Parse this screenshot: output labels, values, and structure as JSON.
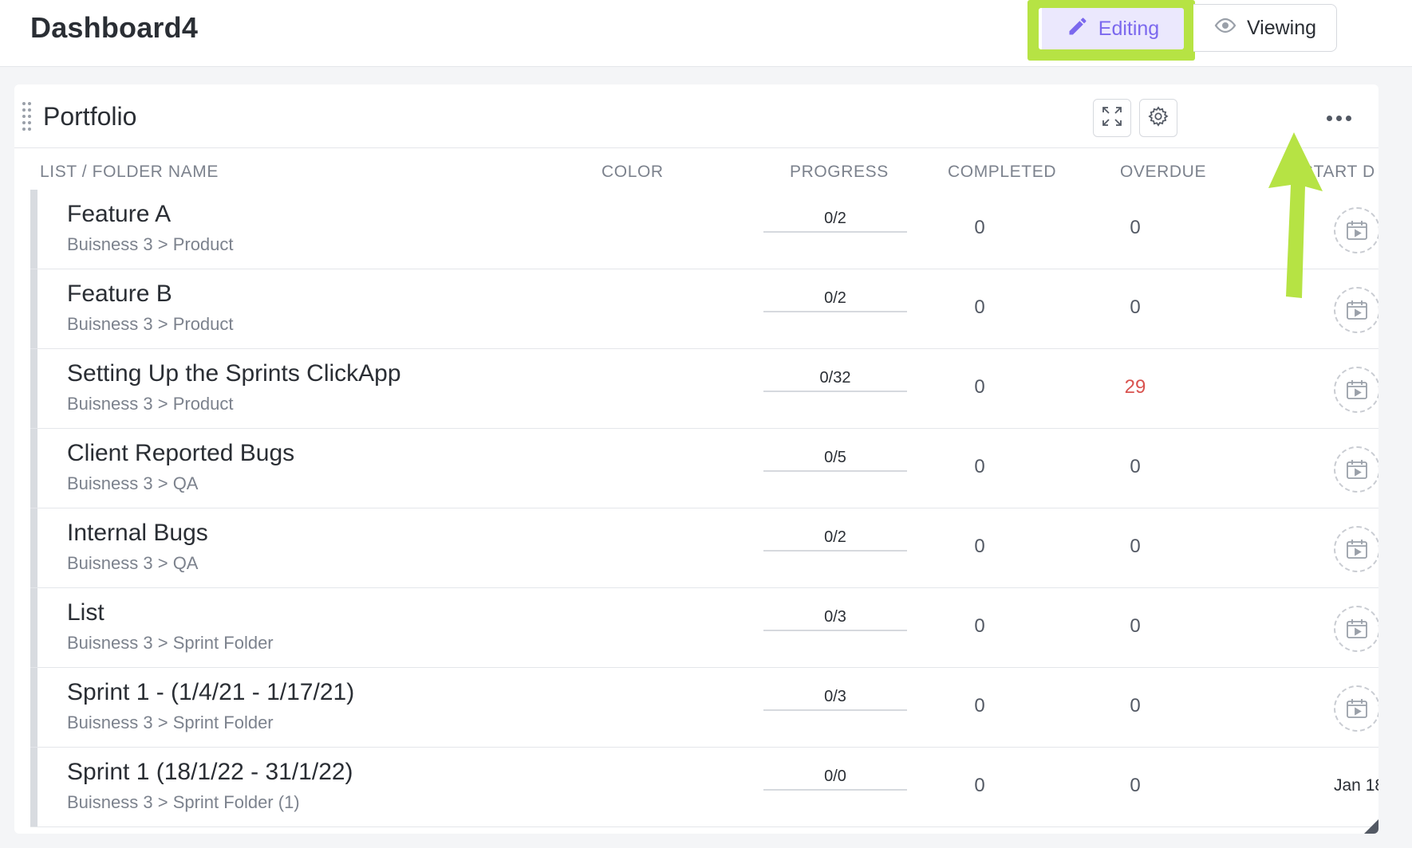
{
  "header": {
    "title": "Dashboard4",
    "editing_label": "Editing",
    "viewing_label": "Viewing",
    "highlight_color": "#b6e344"
  },
  "widget": {
    "title": "Portfolio",
    "actions": [
      "expand-icon",
      "gear-icon",
      "more-icon"
    ]
  },
  "table": {
    "columns": [
      "LIST / FOLDER NAME",
      "COLOR",
      "PROGRESS",
      "COMPLETED",
      "OVERDUE",
      "START D"
    ],
    "rows": [
      {
        "name": "Feature A",
        "path": "Buisness 3 > Product",
        "progress": "0/2",
        "completed": "0",
        "overdue": "0",
        "start": ""
      },
      {
        "name": "Feature B",
        "path": "Buisness 3 > Product",
        "progress": "0/2",
        "completed": "0",
        "overdue": "0",
        "start": ""
      },
      {
        "name": "Setting Up the Sprints ClickApp",
        "path": "Buisness 3 > Product",
        "progress": "0/32",
        "completed": "0",
        "overdue": "29",
        "start": ""
      },
      {
        "name": "Client Reported Bugs",
        "path": "Buisness 3 > QA",
        "progress": "0/5",
        "completed": "0",
        "overdue": "0",
        "start": ""
      },
      {
        "name": "Internal Bugs",
        "path": "Buisness 3 > QA",
        "progress": "0/2",
        "completed": "0",
        "overdue": "0",
        "start": ""
      },
      {
        "name": "List",
        "path": "Buisness 3 > Sprint Folder",
        "progress": "0/3",
        "completed": "0",
        "overdue": "0",
        "start": ""
      },
      {
        "name": "Sprint 1 - (1/4/21 - 1/17/21)",
        "path": "Buisness 3 > Sprint Folder",
        "progress": "0/3",
        "completed": "0",
        "overdue": "0",
        "start": ""
      },
      {
        "name": "Sprint 1 (18/1/22 - 31/1/22)",
        "path": "Buisness 3 > Sprint Folder (1)",
        "progress": "0/0",
        "completed": "0",
        "overdue": "0",
        "start": "Jan 18"
      }
    ]
  }
}
